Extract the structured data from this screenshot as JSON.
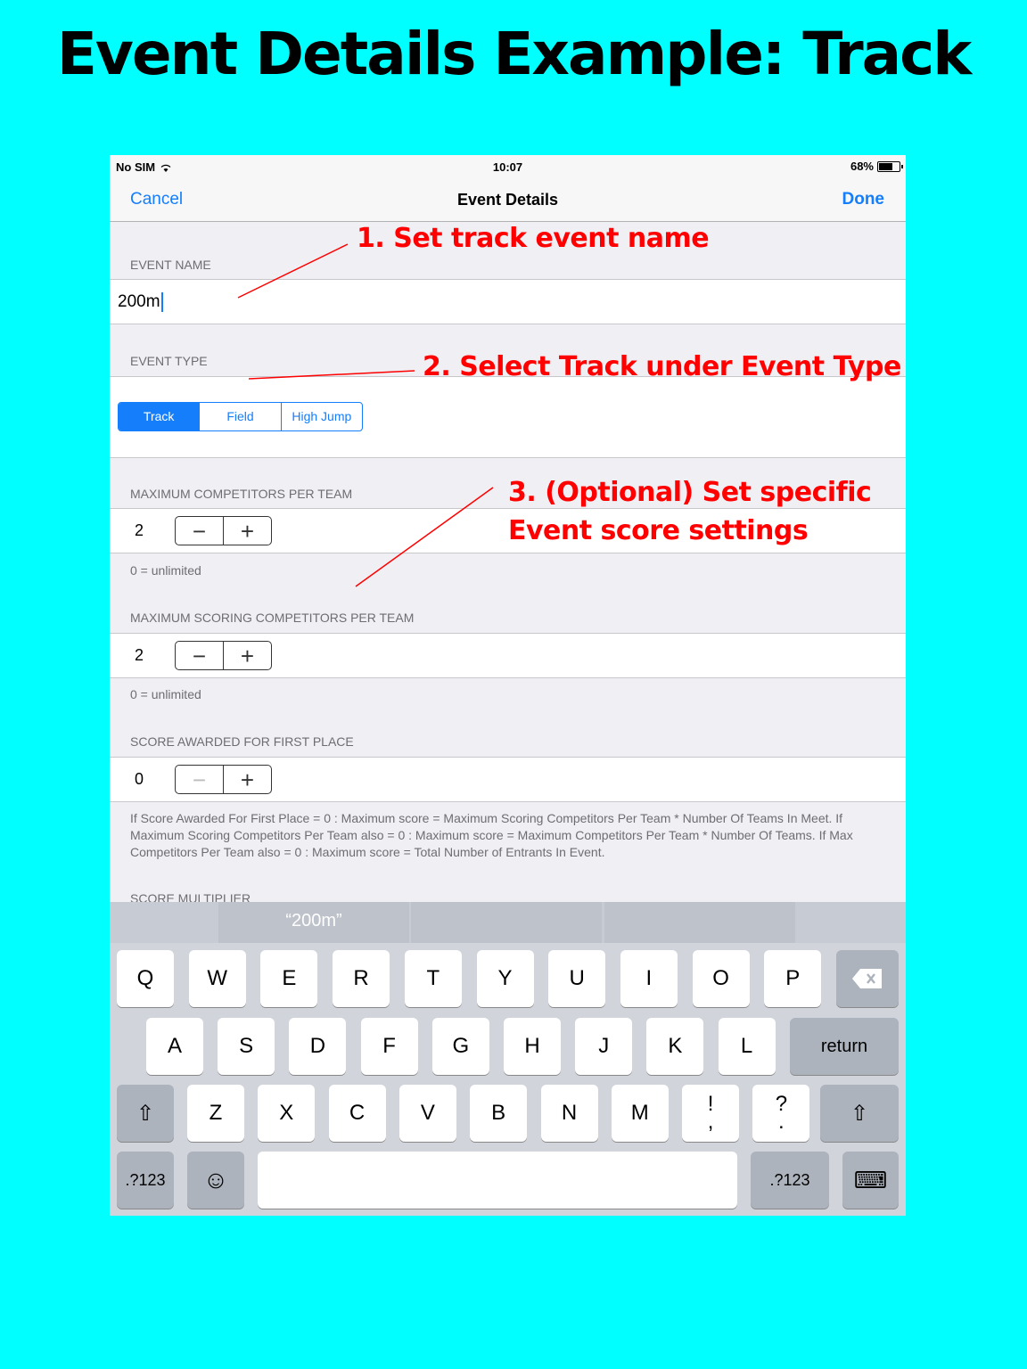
{
  "headline": "Event Details Example: Track",
  "status": {
    "carrier": "No SIM",
    "time": "10:07",
    "battery": "68%"
  },
  "nav": {
    "cancel": "Cancel",
    "title": "Event Details",
    "done": "Done"
  },
  "event_name": {
    "header": "EVENT NAME",
    "value": "200m"
  },
  "event_type": {
    "header": "EVENT TYPE",
    "options": [
      "Track",
      "Field",
      "High Jump"
    ],
    "selected": "Track"
  },
  "max_competitors": {
    "header": "MAXIMUM COMPETITORS PER TEAM",
    "value": "2",
    "footer": "0 = unlimited"
  },
  "max_scoring": {
    "header": "MAXIMUM SCORING COMPETITORS PER TEAM",
    "value": "2",
    "footer": "0 = unlimited"
  },
  "first_place": {
    "header": "SCORE AWARDED FOR FIRST PLACE",
    "value": "0"
  },
  "info_text": "If Score Awarded For First Place = 0 : Maximum score = Maximum Scoring Competitors Per Team * Number Of Teams In Meet. If Maximum Scoring Competitors Per Team also = 0 : Maximum score = Maximum Competitors Per Team * Number Of Teams.  If Max Competitors Per Team also = 0 : Maximum score = Total Number of Entrants In Event.",
  "multiplier_header": "SCORE MULTIPLIER",
  "stepper": {
    "minus": "−",
    "plus": "+"
  },
  "suggestion": "“200m”",
  "keys": {
    "row1": [
      "Q",
      "W",
      "E",
      "R",
      "T",
      "Y",
      "U",
      "I",
      "O",
      "P"
    ],
    "row2": [
      "A",
      "S",
      "D",
      "F",
      "G",
      "H",
      "J",
      "K",
      "L"
    ],
    "row3": [
      "Z",
      "X",
      "C",
      "V",
      "B",
      "N",
      "M",
      "!\n,",
      "?\n."
    ],
    "return": "return",
    "numbers": ".?123",
    "emoji": "☺",
    "delete": "⌫",
    "shift": "⇧",
    "dismiss": "⌨"
  },
  "annotations": {
    "a1": "1. Set track event name",
    "a2": "2. Select Track  under Event Type",
    "a3_line1": "3. (Optional) Set specific",
    "a3_line2": "Event score settings"
  }
}
